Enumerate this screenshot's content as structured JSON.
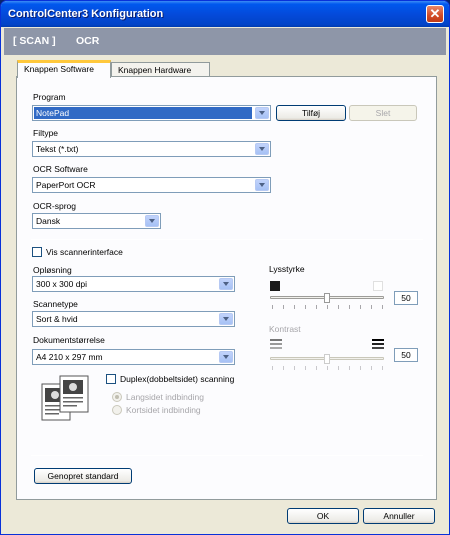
{
  "window": {
    "title": "ControlCenter3 Konfiguration",
    "close_label": "✕"
  },
  "header": {
    "scan_label": "[ SCAN ]",
    "ocr_label": "OCR"
  },
  "tabs": [
    {
      "label": "Knappen Software",
      "active": true
    },
    {
      "label": "Knappen Hardware",
      "active": false
    }
  ],
  "program": {
    "label": "Program",
    "value": "NotePad",
    "add_button": "Tilføj",
    "delete_button": "Slet"
  },
  "filetype": {
    "label": "Filtype",
    "value": "Tekst (*.txt)"
  },
  "ocr_software": {
    "label": "OCR Software",
    "value": "PaperPort OCR"
  },
  "ocr_language": {
    "label": "OCR-sprog",
    "value": "Dansk"
  },
  "show_scanner_interface": {
    "label": "Vis scannerinterface",
    "checked": false
  },
  "resolution": {
    "label": "Opløsning",
    "value": "300 x 300 dpi"
  },
  "scan_type": {
    "label": "Scannetype",
    "value": "Sort & hvid"
  },
  "document_size": {
    "label": "Dokumentstørrelse",
    "value": "A4 210 x 297 mm"
  },
  "brightness": {
    "label": "Lysstyrke",
    "value": "50",
    "level": 0.5
  },
  "contrast": {
    "label": "Kontrast",
    "value": "50",
    "level": 0.5,
    "enabled": false
  },
  "duplex": {
    "label": "Duplex(dobbeltsidet) scanning",
    "checked": false,
    "options": [
      "Langsidet indbinding",
      "Kortsidet indbinding"
    ],
    "selected": "Langsidet indbinding"
  },
  "restore_default_button": "Genopret standard",
  "ok_button": "OK",
  "cancel_button": "Annuller"
}
